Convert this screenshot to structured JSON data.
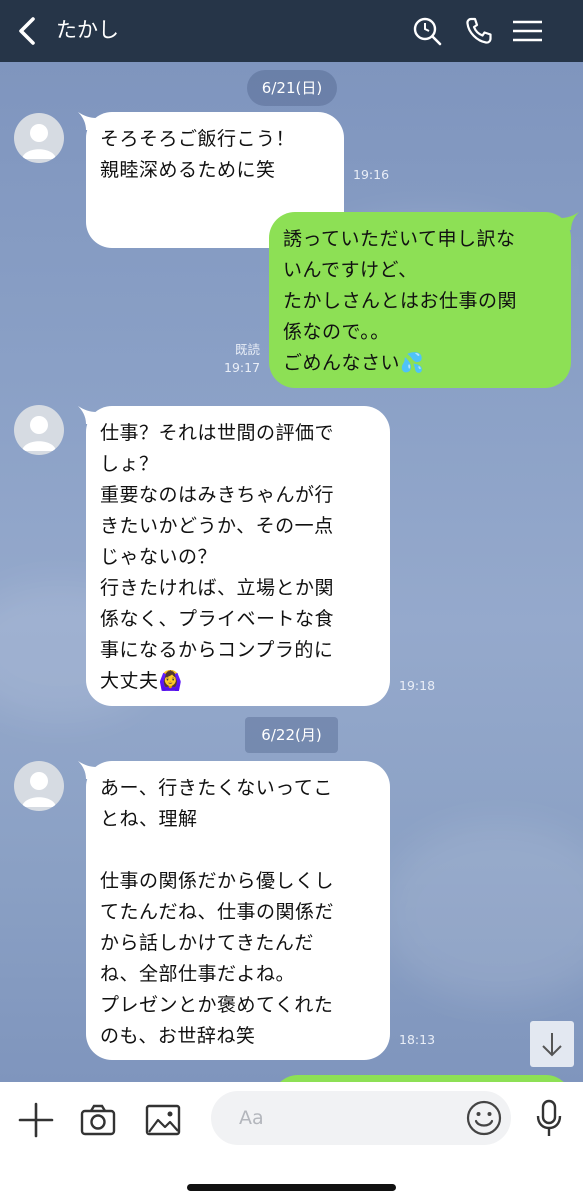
{
  "header": {
    "contact_name": "たかし"
  },
  "chat": {
    "date_1": "6/21(日)",
    "date_2": "6/22(月)",
    "messages": [
      {
        "sender": "incoming",
        "text": "そろそろご飯行こう！\n親睦深めるために笑",
        "time": "19:16"
      },
      {
        "sender": "outgoing",
        "text": "誘っていただいて申し訳な\nいんですけど、\nたかしさんとはお仕事の関\n係なので。。\nごめんなさい💦",
        "read": "既読",
        "time": "19:17"
      },
      {
        "sender": "incoming",
        "text": "仕事？それは世間の評価で\nしょ？\n重要なのはみきちゃんが行\nきたいかどうか、その一点\nじゃないの？\n行きたければ、立場とか関\n係なく、プライベートな食\n事になるからコンプラ的に\n大丈夫🙆‍♀️",
        "time": "19:18"
      },
      {
        "sender": "incoming",
        "text": "あー、行きたくないってこ\nとね、理解\n\n仕事の関係だから優しくし\nてたんだね、仕事の関係だ\nから話しかけてきたんだ\nね、全部仕事だよね。\nプレゼンとか褒めてくれた\nのも、お世辞ね笑",
        "time": "18:13"
      }
    ]
  },
  "input": {
    "placeholder": "Aa"
  },
  "colors": {
    "header_bg": "#263548",
    "incoming_bubble": "#ffffff",
    "outgoing_bubble": "#8de055",
    "chat_bg": "#8aa0c6"
  },
  "icons": {
    "back": "chevron-left-icon",
    "search": "search-icon",
    "call": "phone-icon",
    "menu": "menu-icon",
    "plus": "plus-icon",
    "camera": "camera-icon",
    "image": "image-icon",
    "emoji": "emoji-icon",
    "mic": "microphone-icon",
    "scroll_down": "arrow-down-icon"
  }
}
